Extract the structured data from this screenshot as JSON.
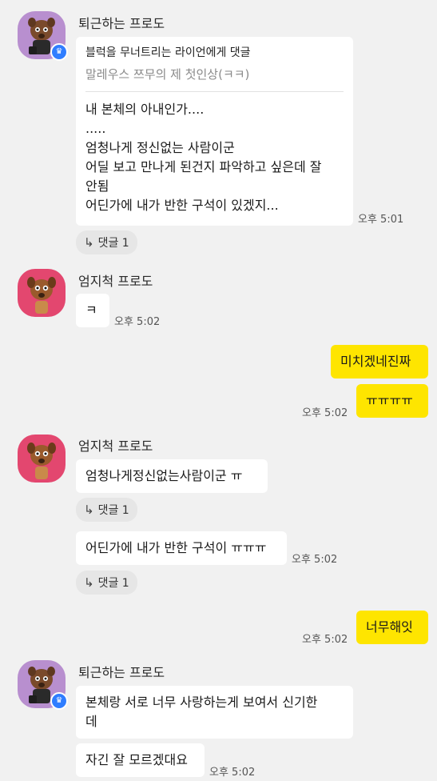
{
  "messages": [
    {
      "sender": "퇴근하는 프로도",
      "reply_quote": {
        "title": "블럭을 무너트리는 라이언에게 댓글",
        "subtitle": "말레우스 쯔무의 제 첫인상(ㅋㅋ)"
      },
      "lines": [
        "내 본체의 아내인가....",
        ".....",
        "엄청나게 정신없는 사람이군",
        "어딜 보고 만나게 된건지 파악하고 싶은데 잘",
        "안됨",
        "어딘가에 내가 반한 구석이 있겠지..."
      ],
      "time": "오후 5:01",
      "reply_count_label": "댓글 1"
    },
    {
      "sender": "엄지척 프로도",
      "text": "ㅋ",
      "time": "오후 5:02"
    },
    {
      "sender": "me",
      "texts": [
        "미치겠네진짜",
        "ㅠㅠㅠㅠ"
      ],
      "time": "오후 5:02"
    },
    {
      "sender": "엄지척 프로도",
      "text": "엄청나게정신없는사람이군 ㅠ",
      "reply_count_label": "댓글 1",
      "text2": "어딘가에 내가 반한 구석이 ㅠㅠㅠ",
      "time": "오후 5:02",
      "reply_count_label2": "댓글 1"
    },
    {
      "sender": "me",
      "text": "너무해잇",
      "time": "오후 5:02"
    },
    {
      "sender": "퇴근하는 프로도",
      "lines": [
        "본체랑 서로 너무 사랑하는게 보여서 신기한",
        "데"
      ],
      "text2": "자긴 잘 모르겠대요",
      "time": "오후 5:02"
    }
  ],
  "colors": {
    "background": "#f1f1f1",
    "my_bubble": "#fee500",
    "their_bubble": "#ffffff",
    "badge": "#2f7dff"
  }
}
